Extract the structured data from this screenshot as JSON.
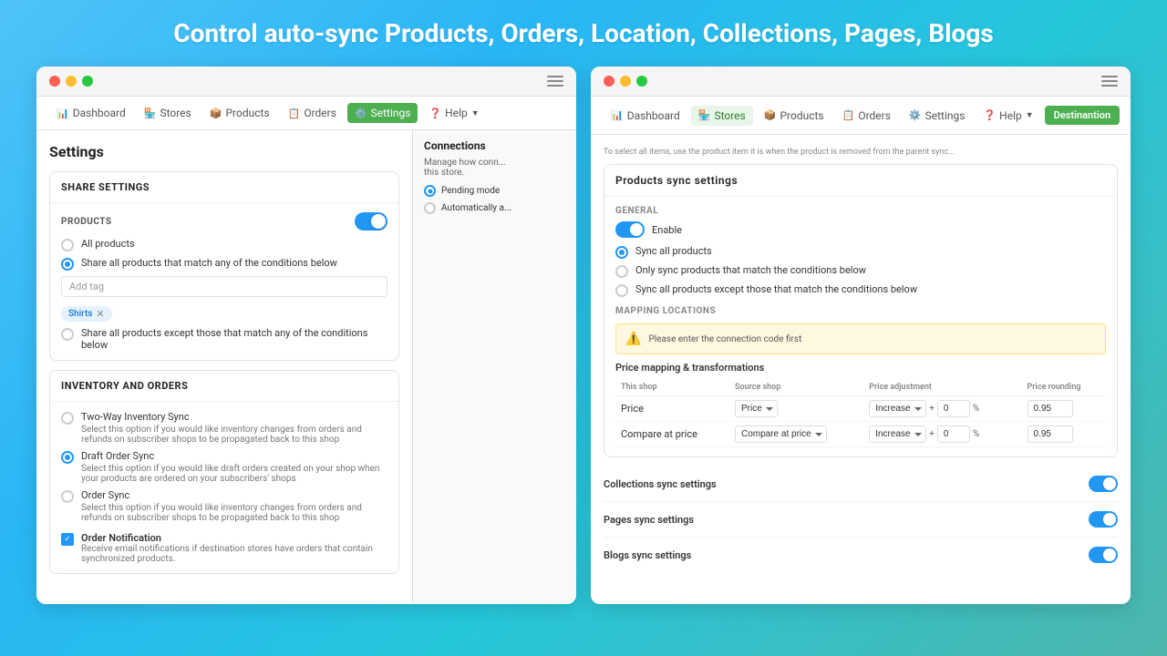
{
  "headline": "Control auto-sync Products, Orders, Location, Collections, Pages, Blogs",
  "left_panel": {
    "title": "Settings",
    "share_settings": {
      "label": "Share settings",
      "products_label": "PRODUCTS",
      "toggle_on": true,
      "radio_options": [
        {
          "id": "all",
          "label": "All products",
          "checked": false
        },
        {
          "id": "match",
          "label": "Share all products that match any of the conditions below",
          "checked": true
        },
        {
          "id": "except",
          "label": "Share all products except those that match any of the conditions below",
          "checked": false
        }
      ],
      "tag_placeholder": "Add tag",
      "tag": "Shirts"
    },
    "inventory_orders": {
      "label": "Inventory and Orders",
      "radio_options": [
        {
          "id": "two_way",
          "label": "Two-Way Inventory Sync",
          "checked": false,
          "desc": "Select this option if you would like inventory changes from orders and refunds on subscriber shops to be propagated back to this shop"
        },
        {
          "id": "draft",
          "label": "Draft Order Sync",
          "checked": true,
          "desc": "Select this option if you would like draft orders created on your shop when your products are ordered on your subscribers' shops"
        },
        {
          "id": "order_sync",
          "label": "Order Sync",
          "checked": false,
          "desc": "Select this option if you would like inventory changes from orders and refunds on subscriber shops to be propagated back to this shop"
        }
      ],
      "notification": {
        "label": "Order Notification",
        "checked": true,
        "desc": "Receive email notifications if destination stores have orders that contain synchronized products."
      }
    },
    "connections": {
      "title": "Connections",
      "text": "Manage how conn... this store.",
      "pending_options": [
        {
          "label": "Pending mode",
          "checked": true
        },
        {
          "label": "Automatically a...",
          "checked": false
        }
      ]
    }
  },
  "right_panel": {
    "nav": {
      "dashboard": "Dashboard",
      "stores": "Stores",
      "products": "Products",
      "orders": "Orders",
      "settings": "Settings",
      "help": "Help",
      "destination_badge": "Destinantion"
    },
    "products_sync": {
      "title": "Products sync settings",
      "general_label": "General",
      "enable_label": "Enable",
      "radio_options": [
        {
          "label": "Sync all products",
          "checked": true
        },
        {
          "label": "Only sync products that match the conditions below",
          "checked": false
        },
        {
          "label": "Sync all products except those that match the conditions below",
          "checked": false
        }
      ],
      "mapping_locations_label": "MAPPING LOCATIONS",
      "warning_text": "Please enter the connection code first",
      "price_mapping_title": "Price mapping & transformations",
      "table_headers": [
        "This shop",
        "Source shop",
        "Price adjustment",
        "Price rounding"
      ],
      "table_rows": [
        {
          "this_shop": "Price",
          "source_shop": "Price",
          "adjustment_type": "Increase",
          "adjustment_value": "0",
          "rounding": "0.95"
        },
        {
          "this_shop": "Compare at price",
          "source_shop": "Compare at price",
          "adjustment_type": "Increase",
          "adjustment_value": "0",
          "rounding": "0.95"
        }
      ]
    },
    "collections_sync": {
      "label": "Collections sync settings",
      "toggle_on": true
    },
    "pages_sync": {
      "label": "Pages sync settings",
      "toggle_on": true
    },
    "blogs_sync": {
      "label": "Blogs sync settings",
      "toggle_on": true
    }
  },
  "nav_left": {
    "items": [
      {
        "icon": "📊",
        "label": "Dashboard"
      },
      {
        "icon": "🏪",
        "label": "Stores"
      },
      {
        "icon": "📦",
        "label": "Products"
      },
      {
        "icon": "📋",
        "label": "Orders"
      },
      {
        "icon": "⚙️",
        "label": "Settings",
        "active": true
      },
      {
        "icon": "❓",
        "label": "Help"
      }
    ]
  }
}
